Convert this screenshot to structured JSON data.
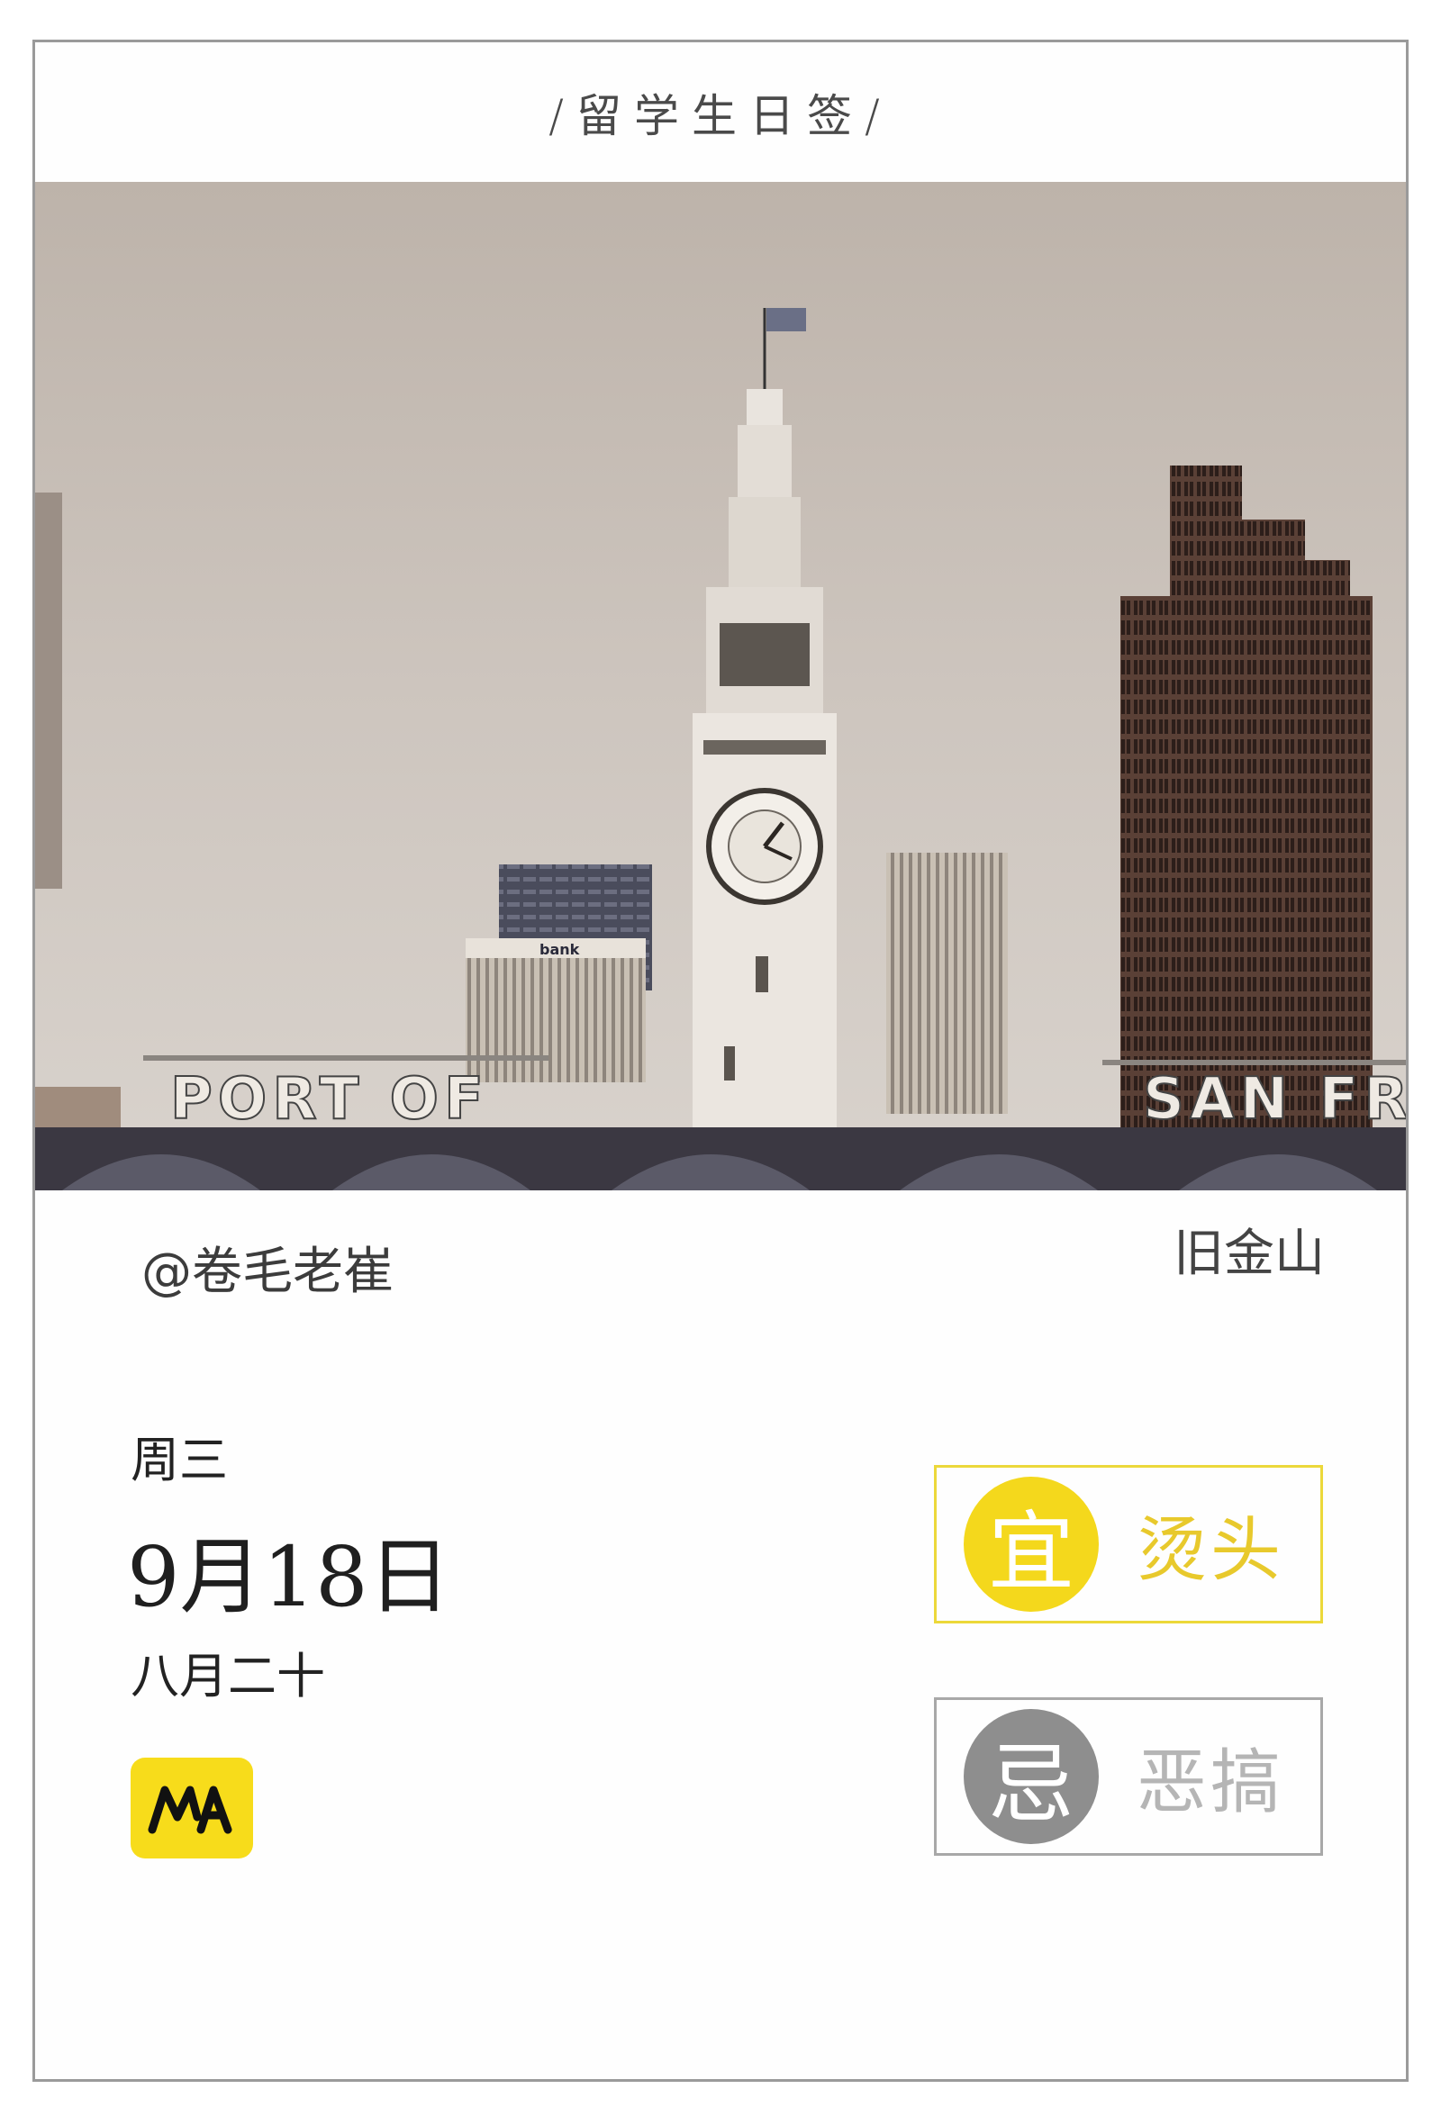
{
  "header": {
    "title": "/留学生日签/"
  },
  "photo": {
    "signs": {
      "left": "PORT OF",
      "right": "SAN FR",
      "bank": "bank"
    }
  },
  "caption": {
    "author": "@卷毛老崔",
    "location": "旧金山"
  },
  "date": {
    "weekday": "周三",
    "date": "9月18日",
    "lunar": "八月二十"
  },
  "logo": {
    "icon": "ma-logo-icon",
    "color": "#f7dc1b"
  },
  "advice": {
    "yi": {
      "label": "宜",
      "text": "烫头",
      "color": "#f4d81c"
    },
    "ji": {
      "label": "忌",
      "text": "恶搞",
      "color": "#8e8e8e"
    }
  }
}
